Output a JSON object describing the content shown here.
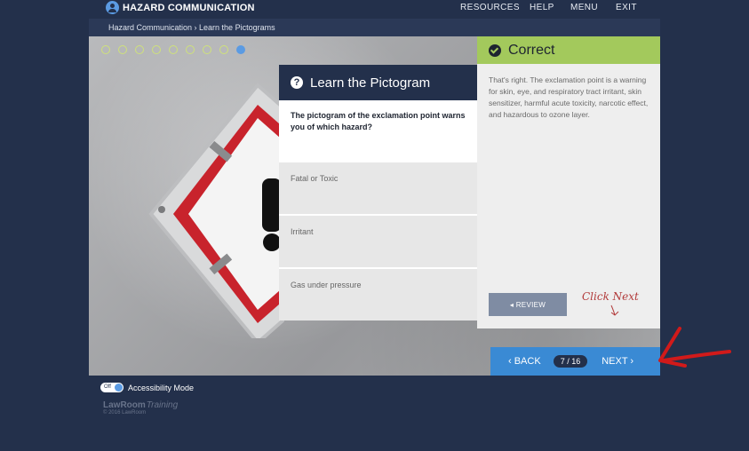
{
  "header": {
    "logo": "HAZARD COMMUNICATION",
    "nav": [
      "RESOURCES",
      "HELP",
      "MENU",
      "EXIT"
    ]
  },
  "breadcrumb": "Hazard Communication  ›  Learn the Pictograms",
  "progress": {
    "total": 9,
    "current": 9
  },
  "question": {
    "title": "Learn the Pictogram",
    "icon": "?",
    "text": "The pictogram of the exclamation point warns you of which hazard?",
    "options": [
      "Fatal or Toxic",
      "Irritant",
      "Gas under pressure"
    ]
  },
  "feedback": {
    "title": "Correct",
    "text": "That's right. The exclamation point is a warning for skin, eye, and respiratory tract irritant, skin sensitizer, harmful acute toxicity, narcotic effect, and hazardous to ozone layer.",
    "review_label": "◂  REVIEW",
    "annotation": "Click Next"
  },
  "pager": {
    "back": "‹  BACK",
    "counter": "7 / 16",
    "next": "NEXT  ›"
  },
  "footer": {
    "toggle_state": "Off",
    "accessibility": "Accessibility Mode",
    "brand_a": "LawRoom",
    "brand_b": "Training",
    "copyright": "© 2016 LawRoom"
  },
  "colors": {
    "navy": "#23304b",
    "green": "#a3c95c",
    "blue": "#3a8ad4",
    "red": "#c8232c"
  }
}
